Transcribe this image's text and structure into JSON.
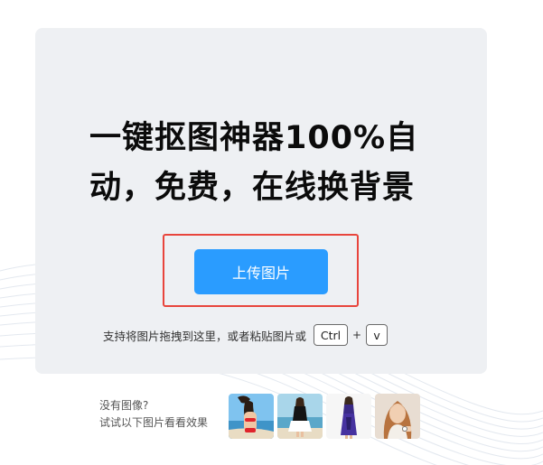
{
  "hero": {
    "title_line1": "一键抠图神器100%自",
    "title_line2": "动，免费，在线换背景"
  },
  "upload": {
    "button_label": "上传图片"
  },
  "hint": {
    "text": "支持将图片拖拽到这里，或者粘贴图片或",
    "key_ctrl": "Ctrl",
    "plus": "+",
    "key_v": "v"
  },
  "samples": {
    "line1": "没有图像?",
    "line2": "试试以下图片看看效果",
    "thumbnails": [
      {
        "name": "woman-beach-red-bikini"
      },
      {
        "name": "woman-black-dress-beach"
      },
      {
        "name": "woman-purple-dress"
      },
      {
        "name": "woman-portrait-watch"
      }
    ]
  },
  "colors": {
    "card_background": "#eef0f3",
    "button_blue": "#2a9cff",
    "highlight_red": "#e8453c"
  }
}
